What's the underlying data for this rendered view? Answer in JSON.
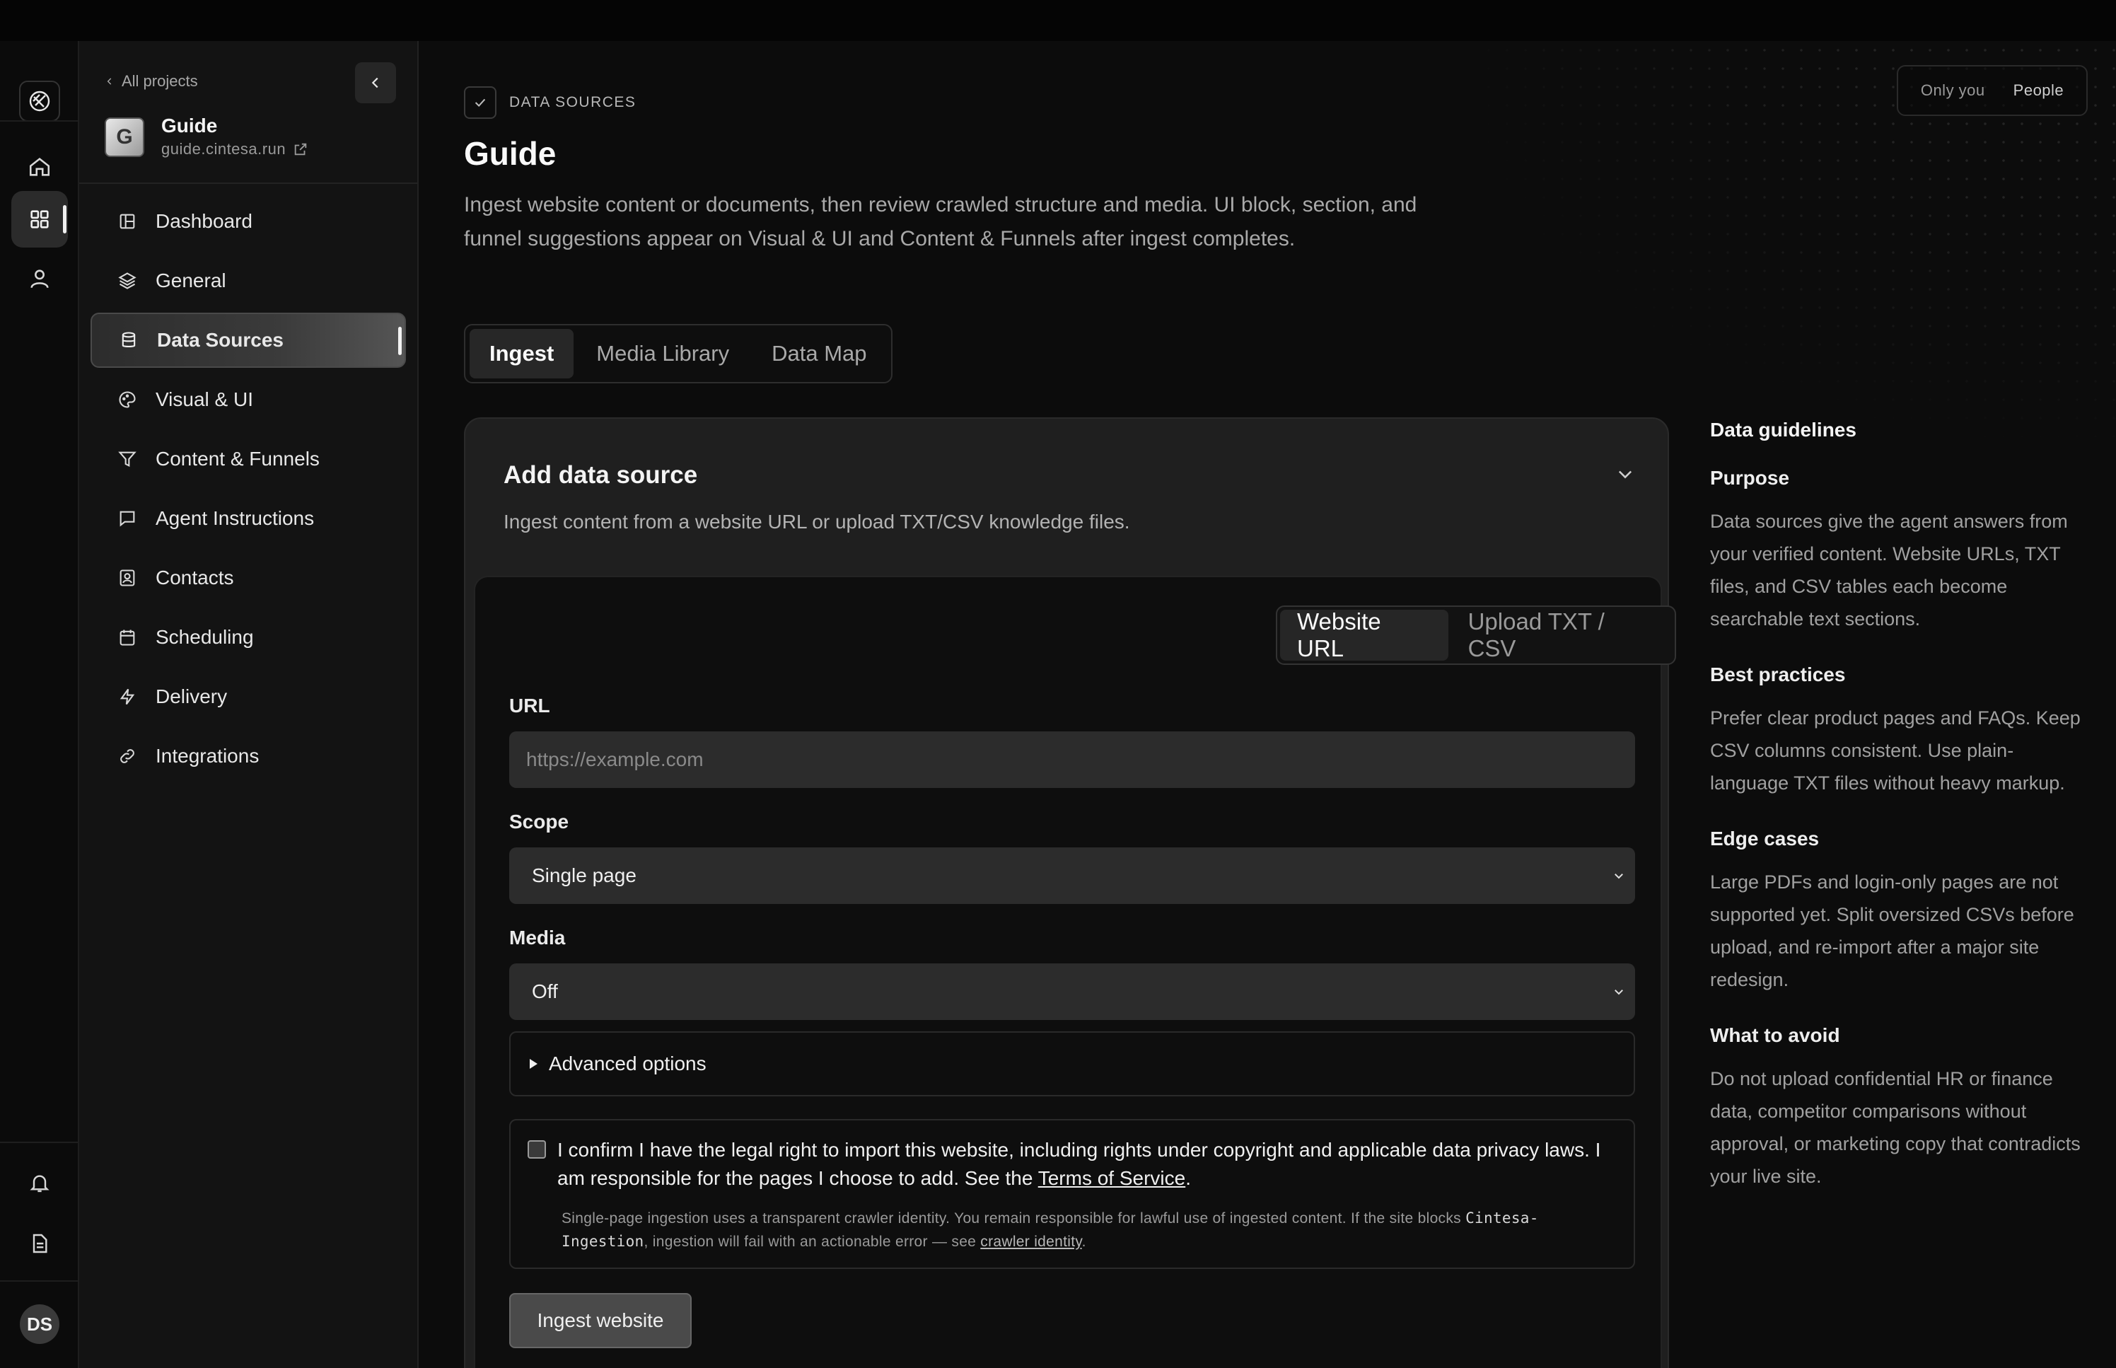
{
  "sidebar": {
    "back_label": "All projects",
    "project_initials": "G",
    "project_name": "Guide",
    "project_url": "guide.cintesa.run",
    "items": [
      {
        "label": "Dashboard"
      },
      {
        "label": "General"
      },
      {
        "label": "Data Sources"
      },
      {
        "label": "Visual & UI"
      },
      {
        "label": "Content & Funnels"
      },
      {
        "label": "Agent Instructions"
      },
      {
        "label": "Contacts"
      },
      {
        "label": "Scheduling"
      },
      {
        "label": "Delivery"
      },
      {
        "label": "Integrations"
      }
    ],
    "active_index": 2
  },
  "rail": {
    "avatar_initials": "DS"
  },
  "header": {
    "breadcrumb": "DATA SOURCES",
    "title": "Guide",
    "description": "Ingest website content or documents, then review crawled structure and media. UI block, section, and funnel suggestions appear on Visual & UI and Content & Funnels after ingest completes.",
    "visibility": {
      "option_a": "Only you",
      "option_b": "People"
    }
  },
  "tabs": [
    {
      "label": "Ingest"
    },
    {
      "label": "Media Library"
    },
    {
      "label": "Data Map"
    }
  ],
  "card": {
    "title": "Add data source",
    "subtitle": "Ingest content from a website URL or upload TXT/CSV knowledge files.",
    "modes": [
      {
        "label": "Website URL"
      },
      {
        "label": "Upload TXT / CSV"
      }
    ],
    "url_label": "URL",
    "url_placeholder": "https://example.com",
    "scope_label": "Scope",
    "scope_value": "Single page",
    "media_label": "Media",
    "media_value": "Off",
    "advanced_label": "Advanced options",
    "consent_text": "I confirm I have the legal right to import this website, including rights under copyright and applicable data privacy laws. I am responsible for the pages I choose to add. See the",
    "consent_link": "Terms of Service",
    "fine_print_a": "Single-page ingestion uses a transparent crawler identity. You remain responsible for lawful use of ingested content. If the site blocks",
    "fine_print_code": "Cintesa-Ingestion",
    "fine_print_b": ", ingestion will fail with an actionable error — see",
    "fine_print_link": "crawler identity",
    "submit_label": "Ingest website"
  },
  "guidelines": {
    "title": "Data guidelines",
    "sections": [
      {
        "heading": "Purpose",
        "body": "Data sources give the agent answers from your verified content. Website URLs, TXT files, and CSV tables each become searchable text sections."
      },
      {
        "heading": "Best practices",
        "body": "Prefer clear product pages and FAQs. Keep CSV columns consistent. Use plain-language TXT files without heavy markup."
      },
      {
        "heading": "Edge cases",
        "body": "Large PDFs and login-only pages are not supported yet. Split oversized CSVs before upload, and re-import after a major site redesign."
      },
      {
        "heading": "What to avoid",
        "body": "Do not upload confidential HR or finance data, competitor comparisons without approval, or marketing copy that contradicts your live site."
      }
    ]
  },
  "colors": {
    "background": "#0c0c0c",
    "sidebar": "#131313",
    "card": "#1f1f1f",
    "accent": "#f2f2f2"
  }
}
